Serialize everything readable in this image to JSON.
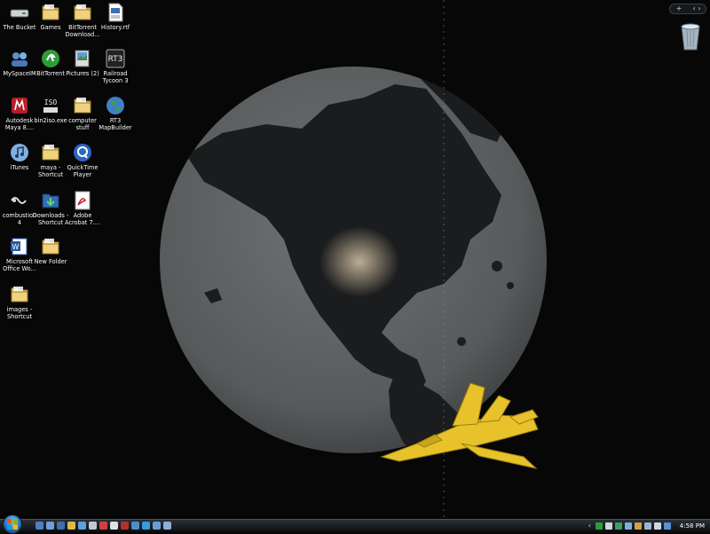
{
  "desktop": {
    "icons": [
      {
        "label": "The Bucket",
        "icon": "drive-icon"
      },
      {
        "label": "Games",
        "icon": "folder-icon"
      },
      {
        "label": "BitTorrent Download...",
        "icon": "folder-icon"
      },
      {
        "label": "History.rtf",
        "icon": "document-icon"
      },
      {
        "label": "MySpaceIM",
        "icon": "messenger-icon"
      },
      {
        "label": "BitTorrent",
        "icon": "bittorrent-icon"
      },
      {
        "label": "Pictures (2)",
        "icon": "pictures-icon"
      },
      {
        "label": "Railroad Tycoon 3",
        "icon": "rt3-icon"
      },
      {
        "label": "Autodesk Maya 8....",
        "icon": "maya-icon"
      },
      {
        "label": "bin2iso.exe",
        "icon": "iso-icon"
      },
      {
        "label": "computer stuff",
        "icon": "folder-icon"
      },
      {
        "label": "RT3 MapBuilder",
        "icon": "globe-icon"
      },
      {
        "label": "iTunes",
        "icon": "itunes-icon"
      },
      {
        "label": "maya - Shortcut",
        "icon": "folder-icon"
      },
      {
        "label": "QuickTime Player",
        "icon": "quicktime-icon"
      },
      {
        "label": "combustion 4",
        "icon": "combustion-icon"
      },
      {
        "label": "Downloads - Shortcut",
        "icon": "downloads-icon"
      },
      {
        "label": "Adobe Acrobat 7....",
        "icon": "acrobat-icon"
      },
      {
        "label": "Microsoft Office Wo...",
        "icon": "word-icon"
      },
      {
        "label": "New Folder",
        "icon": "folder-icon"
      },
      {
        "label": "images - Shortcut",
        "icon": "folder-icon"
      }
    ],
    "recycle_bin_icon": "recycle-bin-icon"
  },
  "sidebar_controls": {
    "add": "+",
    "nav": "‹ ›"
  },
  "taskbar": {
    "start_icon": "windows-logo-icon",
    "tray_arrow": "‹",
    "clock": "4:58 PM"
  },
  "colors": {
    "background": "#070707",
    "globe": "#5f6263",
    "land": "#1b1c1d",
    "jet": "#e8c22a",
    "taskbar": "#1c2127"
  }
}
